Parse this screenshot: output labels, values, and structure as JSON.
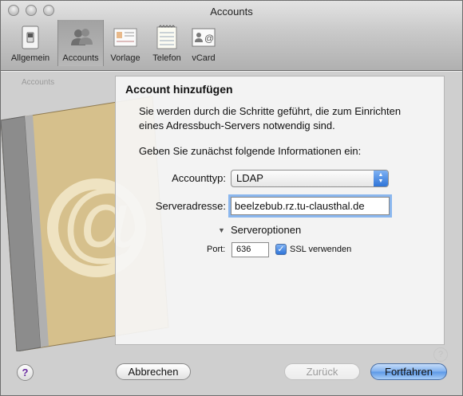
{
  "window": {
    "title": "Accounts"
  },
  "toolbar": {
    "items": [
      {
        "label": "Allgemein",
        "icon": "switch-icon"
      },
      {
        "label": "Accounts",
        "icon": "users-icon"
      },
      {
        "label": "Vorlage",
        "icon": "card-template-icon"
      },
      {
        "label": "Telefon",
        "icon": "notepad-icon"
      },
      {
        "label": "vCard",
        "icon": "vcard-icon"
      }
    ],
    "active": "Accounts"
  },
  "background": {
    "header": "Accounts"
  },
  "sheet": {
    "title": "Account hinzufügen",
    "intro_line1": "Sie werden durch die Schritte geführt, die zum Einrichten",
    "intro_line2": "eines Adressbuch-Servers notwendig sind.",
    "prompt": "Geben Sie zunächst folgende Informationen ein:",
    "account_type_label": "Accounttyp:",
    "account_type_value": "LDAP",
    "server_label": "Serveradresse:",
    "server_value": "beelzebub.rz.tu-clausthal.de",
    "server_options_label": "Serveroptionen",
    "port_label": "Port:",
    "port_value": "636",
    "ssl_label": "SSL verwenden",
    "ssl_checked": true
  },
  "buttons": {
    "help": "?",
    "cancel": "Abbrechen",
    "back": "Zurück",
    "continue": "Fortfahren"
  },
  "colors": {
    "accent": "#3b82e0",
    "focus_ring": "#8bb7ee"
  }
}
